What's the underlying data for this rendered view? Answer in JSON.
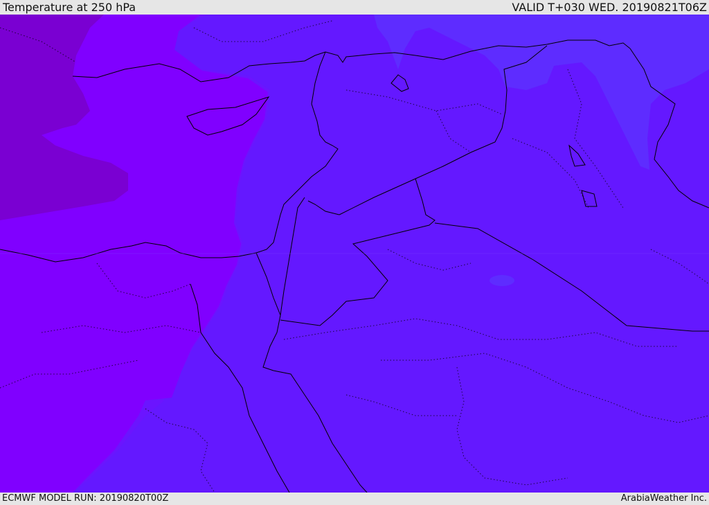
{
  "header": {
    "title": "Temperature at 250 hPa",
    "valid_time": "VALID T+030 WED. 20190821T06Z"
  },
  "footer": {
    "model_run": "ECMWF MODEL RUN: 20190820T00Z",
    "credit": "ArabiaWeather Inc."
  },
  "colors": {
    "background_bar": "#e6e6e6",
    "zone_darkest": "#7a00d2",
    "zone_violet": "#8000ff",
    "zone_purple": "#6a10ff",
    "zone_blue_violet": "#6418ff",
    "zone_light_blue": "#5e2cff",
    "coastline": "#000000"
  }
}
